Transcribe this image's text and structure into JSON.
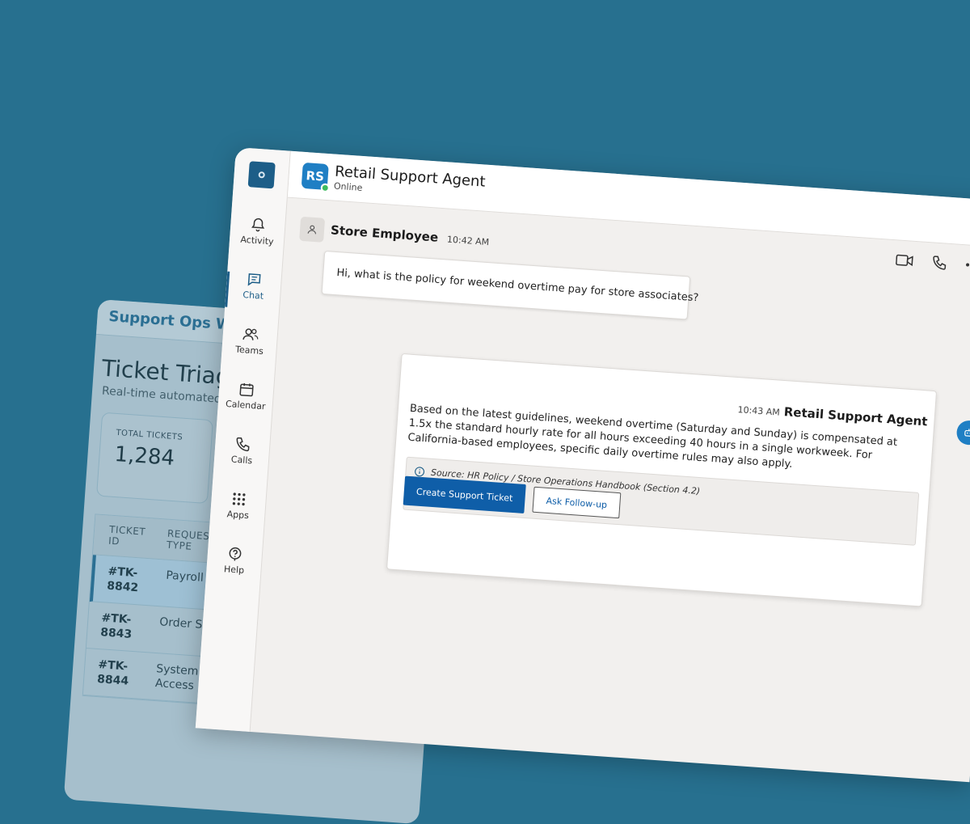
{
  "back_panel": {
    "brand": "Support Ops W",
    "title": "Ticket Triag",
    "subtitle": "Real-time automated",
    "stat": {
      "label": "TOTAL TICKETS",
      "value": "1,284"
    },
    "table": {
      "headers": [
        "TICKET ID",
        "REQUEST TYPE"
      ],
      "rows": [
        {
          "id": "#TK-8842",
          "type": "Payroll Policy"
        },
        {
          "id": "#TK-8843",
          "type": "Order Status"
        },
        {
          "id": "#TK-8844",
          "type": "System Access"
        }
      ]
    }
  },
  "sidebar": {
    "items": [
      {
        "label": "Activity",
        "icon": "bell-icon"
      },
      {
        "label": "Chat",
        "icon": "chat-icon"
      },
      {
        "label": "Teams",
        "icon": "people-icon"
      },
      {
        "label": "Calendar",
        "icon": "calendar-icon"
      },
      {
        "label": "Calls",
        "icon": "phone-icon"
      },
      {
        "label": "Apps",
        "icon": "grid-icon"
      },
      {
        "label": "Help",
        "icon": "help-icon"
      }
    ],
    "active": "Chat"
  },
  "header": {
    "avatar_initials": "RS",
    "agent_name": "Retail Support Agent",
    "status": "Online"
  },
  "messages": {
    "user": {
      "sender": "Store Employee",
      "time": "10:42 AM",
      "text": "Hi, what is the policy for weekend overtime pay for store associates?"
    },
    "bot": {
      "sender": "Retail Support Agent",
      "time": "10:43 AM",
      "text": "Based on the latest guidelines, weekend overtime (Saturday and Sunday) is compensated at 1.5x the standard hourly rate for all hours exceeding 40 hours in a single workweek. For California-based employees, specific daily overtime rules may also apply.",
      "source": "Source: HR Policy / Store Operations Handbook (Section 4.2)",
      "primary_action": "Create Support Ticket",
      "secondary_action": "Ask Follow-up"
    }
  },
  "colors": {
    "background": "#27708f",
    "accent": "#0f5ea8",
    "online": "#3dbb5f"
  }
}
